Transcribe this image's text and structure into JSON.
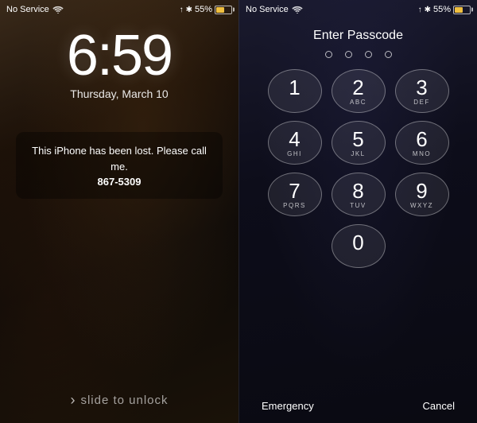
{
  "left": {
    "status": {
      "service": "No Service",
      "percent": "55%"
    },
    "time": "6:59",
    "date": "Thursday, March 10",
    "lost_message": {
      "text": "This iPhone has been lost. Please call me.",
      "phone": "867-5309"
    },
    "slide_label": "slide to unlock"
  },
  "right": {
    "status": {
      "service": "No Service",
      "percent": "55%"
    },
    "title": "Enter Passcode",
    "dots": [
      "empty",
      "empty",
      "empty",
      "empty"
    ],
    "numpad": [
      [
        {
          "number": "1",
          "letters": ""
        },
        {
          "number": "2",
          "letters": "ABC"
        },
        {
          "number": "3",
          "letters": "DEF"
        }
      ],
      [
        {
          "number": "4",
          "letters": "GHI"
        },
        {
          "number": "5",
          "letters": "JKL"
        },
        {
          "number": "6",
          "letters": "MNO"
        }
      ],
      [
        {
          "number": "7",
          "letters": "PQRS"
        },
        {
          "number": "8",
          "letters": "TUV"
        },
        {
          "number": "9",
          "letters": "WXYZ"
        }
      ],
      [
        {
          "number": "0",
          "letters": ""
        }
      ]
    ],
    "emergency_label": "Emergency",
    "cancel_label": "Cancel"
  }
}
